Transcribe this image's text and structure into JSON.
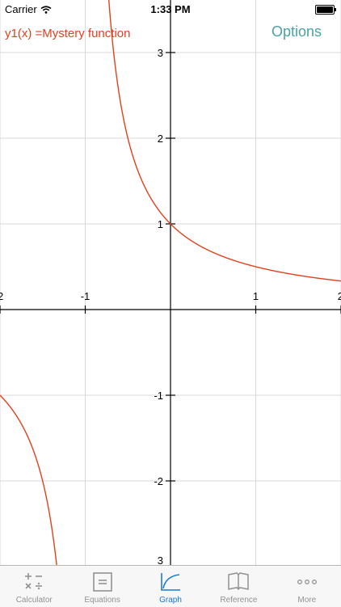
{
  "status_bar": {
    "carrier": "Carrier",
    "time": "1:33 PM"
  },
  "graph": {
    "function_label": "y1(x) =Mystery function",
    "options_label": "Options",
    "curve_color": "#e2401c",
    "x_range": [
      -2,
      2
    ],
    "y_range": [
      -3,
      3.3
    ],
    "x_ticks": [
      {
        "value": -2,
        "label": "2"
      },
      {
        "value": -1,
        "label": "-1"
      },
      {
        "value": 1,
        "label": "1"
      },
      {
        "value": 2,
        "label": "2"
      }
    ],
    "y_ticks": [
      {
        "value": 3,
        "label": "3"
      },
      {
        "value": 2,
        "label": "2"
      },
      {
        "value": 1,
        "label": "1"
      },
      {
        "value": -1,
        "label": "-1"
      },
      {
        "value": -2,
        "label": "-2"
      },
      {
        "value": -3,
        "label": "3"
      }
    ]
  },
  "tab_bar": {
    "active_color": "#1a7ad6",
    "tabs": [
      {
        "label": "Calculator",
        "icon": "calculator-icon",
        "active": false
      },
      {
        "label": "Equations",
        "icon": "equations-icon",
        "active": false
      },
      {
        "label": "Graph",
        "icon": "graph-icon",
        "active": true
      },
      {
        "label": "Reference",
        "icon": "book-icon",
        "active": false
      },
      {
        "label": "More",
        "icon": "more-icon",
        "active": false
      }
    ]
  }
}
